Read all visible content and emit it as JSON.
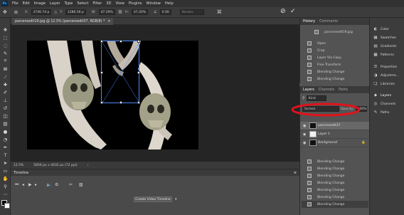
{
  "menubar": {
    "logo": "Ps",
    "items": [
      "File",
      "Edit",
      "Image",
      "Layer",
      "Type",
      "Select",
      "Filter",
      "3D",
      "View",
      "Plugins",
      "Window",
      "Help"
    ]
  },
  "optionsbar": {
    "x_label": "X:",
    "x_value": "3746.74 p",
    "y_label": "Y:",
    "y_value": "1286.56 p",
    "w_label": "W:",
    "w_value": "47.29%",
    "h_label": "H:",
    "h_value": "47.20%",
    "angle_value": "0.00",
    "interp": "Bicubic"
  },
  "document": {
    "tab_title": "parceroedit19.jpg @ 12.5% (parceroedit37, RGB/8) *"
  },
  "statusbar": {
    "zoom": "12.5%",
    "size": "5856 px x 4032 px (72 ppi)"
  },
  "timeline": {
    "title": "Timeline",
    "create_button": "Create Video Timeline"
  },
  "history": {
    "tabs": [
      "History",
      "Comments"
    ],
    "snapshot": "parceroedit19.jpg",
    "items": [
      "Open",
      "Crop",
      "Layer Via Copy",
      "Free Transform",
      "Blending Change",
      "Blending Change",
      "Blending Change"
    ]
  },
  "layers": {
    "tabs": [
      "Layers",
      "Channels",
      "Paths"
    ],
    "search_placeholder": "Kind",
    "blend_mode": "Screen",
    "opacity_label": "Opacity:",
    "opacity_value": "100%",
    "rows": [
      {
        "name": "parceroedit37",
        "thumb": "dark"
      },
      {
        "name": "Layer 1",
        "thumb": "light"
      },
      {
        "name": "Background",
        "thumb": "dark"
      }
    ],
    "history_tail": [
      "Blending Change",
      "Blending Change",
      "Blending Change",
      "Blending Change",
      "Blending Change",
      "Blending Change",
      "Blending Change"
    ]
  },
  "rightcol": {
    "items": [
      "Color",
      "Swatches",
      "Gradients",
      "Patterns",
      "Properties",
      "Adjustme...",
      "Libraries",
      "Layers",
      "Channels",
      "Paths"
    ]
  },
  "colors": {
    "accent_highlight": "#e0121b",
    "menubar_bg": "#323232",
    "panel_bg": "#535353"
  }
}
